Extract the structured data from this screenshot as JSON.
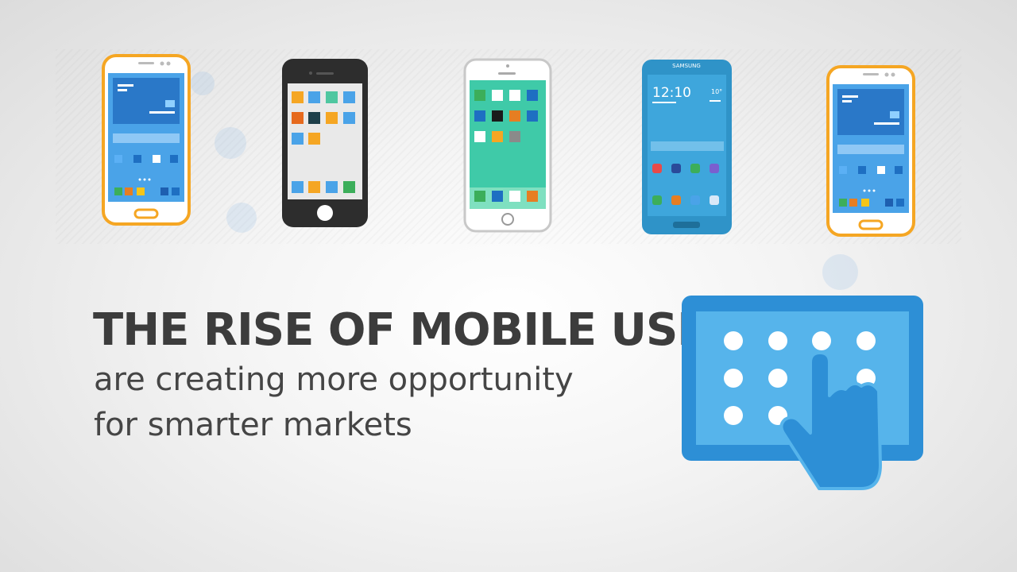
{
  "headline": "THE RISE OF MOBILE USERS",
  "subline_1": "are creating more opportunity",
  "subline_2": "for smarter markets",
  "phones": [
    {
      "style": "android",
      "frame_color": "#f5a623"
    },
    {
      "style": "iphone-dark",
      "frame_color": "#2d2d2d"
    },
    {
      "style": "iphone-light",
      "frame_color": "#c8c8c8"
    },
    {
      "style": "samsung",
      "frame_color": "#2f93c8",
      "brand": "SAMSUNG",
      "clock": "12:10",
      "temp": "10°"
    },
    {
      "style": "android",
      "frame_color": "#f5a623"
    }
  ],
  "colors": {
    "headline": "#3c3c3c",
    "accent_blue": "#2d8fd6",
    "tablet_screen": "#56b4eb"
  },
  "icons": {
    "tablet": "tablet-touch-icon",
    "hand": "pointing-hand-icon"
  }
}
